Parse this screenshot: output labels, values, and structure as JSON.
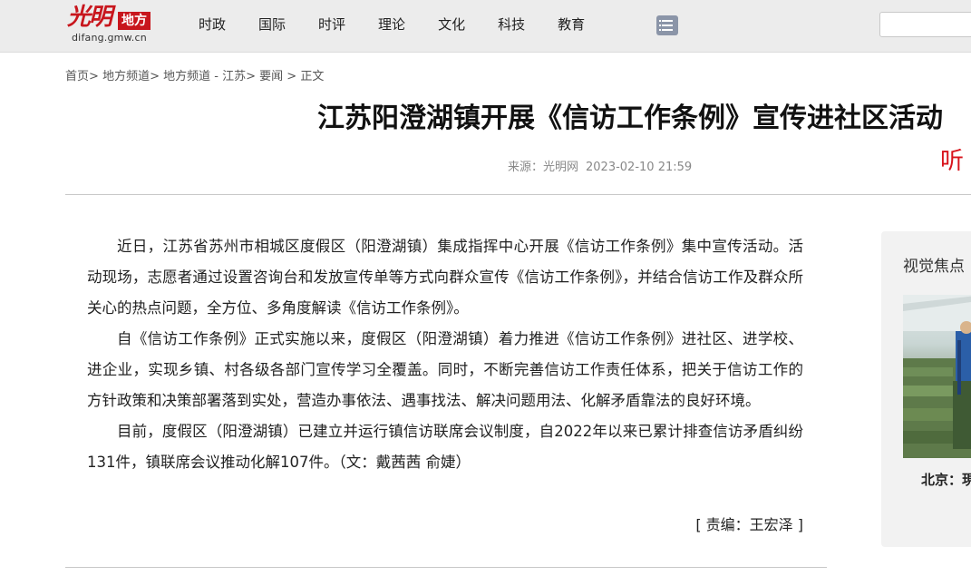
{
  "site": {
    "logo_script": "光明",
    "logo_badge": "地方",
    "logo_url": "difang.gmw.cn"
  },
  "nav": {
    "items": [
      {
        "label": "时政"
      },
      {
        "label": "国际"
      },
      {
        "label": "时评"
      },
      {
        "label": "理论"
      },
      {
        "label": "文化"
      },
      {
        "label": "科技"
      },
      {
        "label": "教育"
      }
    ],
    "menu_icon": "list-menu-icon"
  },
  "search": {
    "placeholder": "",
    "value": ""
  },
  "breadcrumb": {
    "items": [
      "首页",
      "地方频道",
      "地方频道 - 江苏",
      "要闻",
      "正文"
    ],
    "separator": ">"
  },
  "article": {
    "title": "江苏阳澄湖镇开展《信访工作条例》宣传进社区活动",
    "source": "来源：光明网",
    "datetime": "2023-02-10 21:59",
    "listen_label": "听",
    "paragraphs": [
      "近日，江苏省苏州市相城区度假区（阳澄湖镇）集成指挥中心开展《信访工作条例》集中宣传活动。活动现场，志愿者通过设置咨询台和发放宣传单等方式向群众宣传《信访工作条例》，并结合信访工作及群众所关心的热点问题，全方位、多角度解读《信访工作条例》。",
      "自《信访工作条例》正式实施以来，度假区（阳澄湖镇）着力推进《信访工作条例》进社区、进学校、进企业，实现乡镇、村各级各部门宣传学习全覆盖。同时，不断完善信访工作责任体系，把关于信访工作的方针政策和决策部署落到实处，营造办事依法、遇事找法、解决问题用法、化解矛盾靠法的良好环境。",
      "目前，度假区（阳澄湖镇）已建立并运行镇信访联席会议制度，自2022年以来已累计排查信访矛盾纠纷131件，镇联席会议推动化解107件。（文：戴茜茜 俞婕）"
    ],
    "editor": "[ 责编：王宏泽 ]"
  },
  "sidebar": {
    "title": "视觉焦点",
    "caption": "北京：現"
  },
  "colors": {
    "brand_red": "#c8161d",
    "topbar_bg": "#ececec",
    "sidebar_bg": "#f2f2f2"
  }
}
